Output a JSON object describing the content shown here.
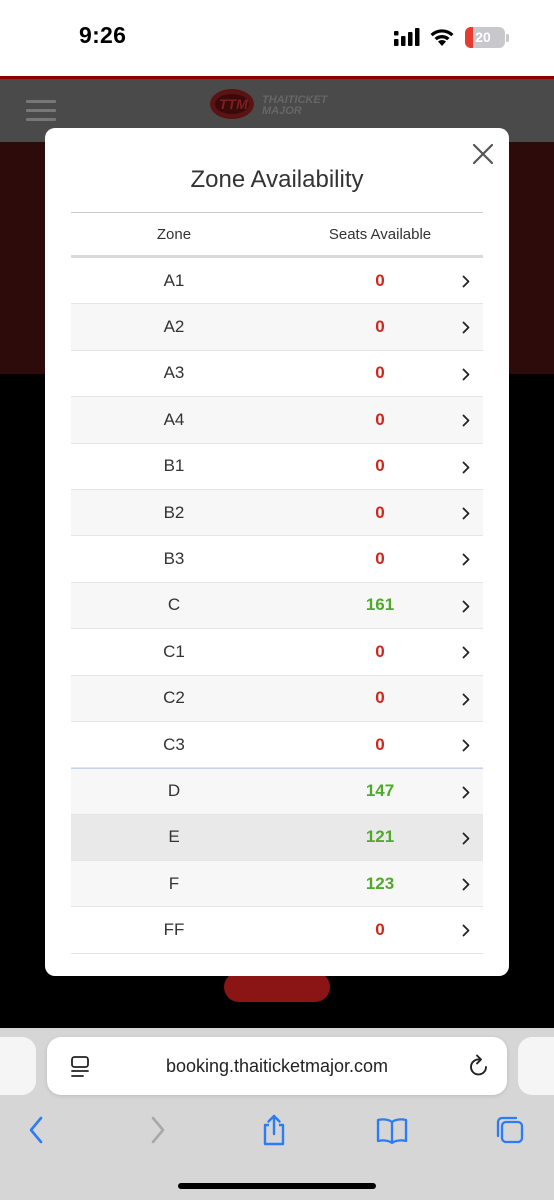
{
  "status_bar": {
    "time": "9:26",
    "battery": "20"
  },
  "site": {
    "logo_line1": "THAITICKET",
    "logo_line2": "MAJOR"
  },
  "modal": {
    "title": "Zone Availability",
    "col_zone": "Zone",
    "col_seats": "Seats Available",
    "rows": [
      {
        "zone": "A1",
        "seats": "0"
      },
      {
        "zone": "A2",
        "seats": "0"
      },
      {
        "zone": "A3",
        "seats": "0"
      },
      {
        "zone": "A4",
        "seats": "0"
      },
      {
        "zone": "B1",
        "seats": "0"
      },
      {
        "zone": "B2",
        "seats": "0"
      },
      {
        "zone": "B3",
        "seats": "0"
      },
      {
        "zone": "C",
        "seats": "161"
      },
      {
        "zone": "C1",
        "seats": "0"
      },
      {
        "zone": "C2",
        "seats": "0"
      },
      {
        "zone": "C3",
        "seats": "0"
      },
      {
        "zone": "D",
        "seats": "147"
      },
      {
        "zone": "E",
        "seats": "121"
      },
      {
        "zone": "F",
        "seats": "123"
      },
      {
        "zone": "FF",
        "seats": "0"
      }
    ]
  },
  "colors": {
    "unavailable": "#d2261c",
    "available": "#52a82b",
    "safari_blue": "#2b7cf6"
  },
  "browser": {
    "url": "booking.thaiticketmajor.com"
  }
}
